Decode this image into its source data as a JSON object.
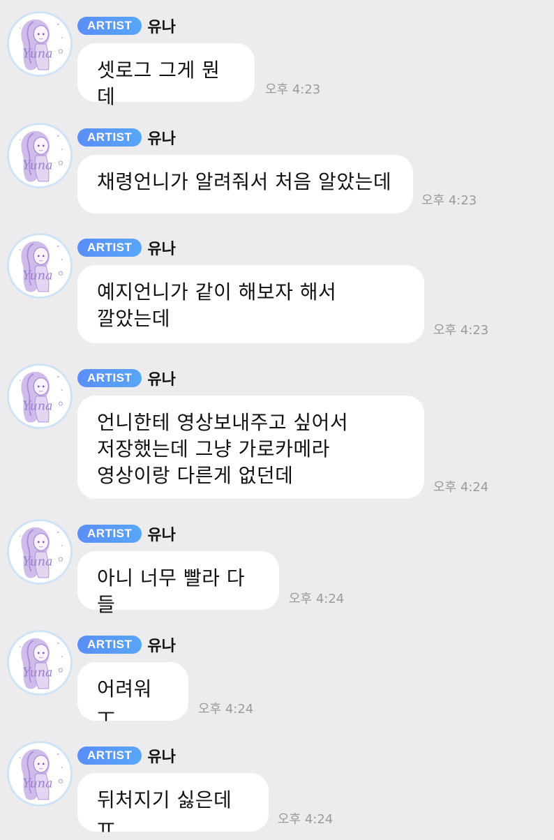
{
  "badge_label": "ARTIST",
  "sender_name": "유나",
  "avatar_signature": "Yuna",
  "colors": {
    "background": "#ececee",
    "bubble": "#ffffff",
    "badge_start": "#5b8ef8",
    "badge_end": "#57a6f7",
    "timestamp": "#9a9a9c",
    "avatar_hair": "#b9a0dc"
  },
  "messages": [
    {
      "text": "셋로그 그게 뭔데",
      "time": "오후 4:23"
    },
    {
      "text": "채령언니가 알려줘서 처음 알았는데",
      "time": "오후 4:23"
    },
    {
      "text": "예지언니가 같이 해보자 해서\n깔았는데",
      "time": "오후 4:23"
    },
    {
      "text": "언니한테 영상보내주고 싶어서\n저장했는데 그냥 가로카메라\n영상이랑 다른게 없던데",
      "time": "오후 4:24"
    },
    {
      "text": "아니 너무 빨라 다들",
      "time": "오후 4:24"
    },
    {
      "text": "어려워ㅜ",
      "time": "오후 4:24"
    },
    {
      "text": "뒤처지기 싫은데ㅠ",
      "time": "오후 4:24"
    }
  ]
}
